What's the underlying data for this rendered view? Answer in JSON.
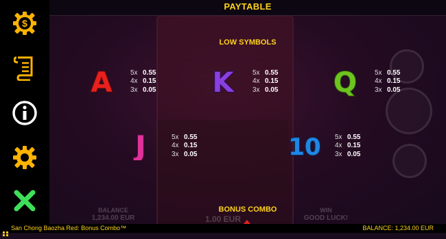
{
  "header": {
    "title": "PAYTABLE"
  },
  "sections": {
    "low_symbols": "LOW SYMBOLS",
    "bonus_combo": "BONUS COMBO"
  },
  "sidebar": {
    "items": [
      {
        "icon": "coin-icon",
        "color": "#ffb400"
      },
      {
        "icon": "scroll-icon",
        "color": "#ffb400"
      },
      {
        "icon": "info-icon",
        "color": "#ffffff"
      },
      {
        "icon": "gear-icon",
        "color": "#ffb400"
      },
      {
        "icon": "close-icon",
        "color": "#3ee05a"
      }
    ]
  },
  "symbols": [
    {
      "id": "A",
      "label": "A",
      "color": "#e8201e",
      "pays": [
        {
          "m": "5x",
          "v": "0.55"
        },
        {
          "m": "4x",
          "v": "0.15"
        },
        {
          "m": "3x",
          "v": "0.05"
        }
      ]
    },
    {
      "id": "K",
      "label": "K",
      "color": "#8a3fe0",
      "pays": [
        {
          "m": "5x",
          "v": "0.55"
        },
        {
          "m": "4x",
          "v": "0.15"
        },
        {
          "m": "3x",
          "v": "0.05"
        }
      ]
    },
    {
      "id": "Q",
      "label": "Q",
      "color": "#6cc420",
      "pays": [
        {
          "m": "5x",
          "v": "0.55"
        },
        {
          "m": "4x",
          "v": "0.15"
        },
        {
          "m": "3x",
          "v": "0.05"
        }
      ]
    },
    {
      "id": "J",
      "label": "J",
      "color": "#e0329a",
      "pays": [
        {
          "m": "5x",
          "v": "0.55"
        },
        {
          "m": "4x",
          "v": "0.15"
        },
        {
          "m": "3x",
          "v": "0.05"
        }
      ]
    },
    {
      "id": "10",
      "label": "10",
      "color": "#1f86e6",
      "pays": [
        {
          "m": "5x",
          "v": "0.55"
        },
        {
          "m": "4x",
          "v": "0.15"
        },
        {
          "m": "3x",
          "v": "0.05"
        }
      ]
    }
  ],
  "hud": {
    "balance_label": "BALANCE",
    "balance_value": "1,234.00 EUR",
    "bet_value": "1.00 EUR",
    "win_label": "WIN",
    "win_value": "GOOD LUCK!"
  },
  "status": {
    "game_name": "San Chong Baozha Red: Bonus Combo™",
    "balance": "BALANCE: 1,234.00 EUR"
  }
}
